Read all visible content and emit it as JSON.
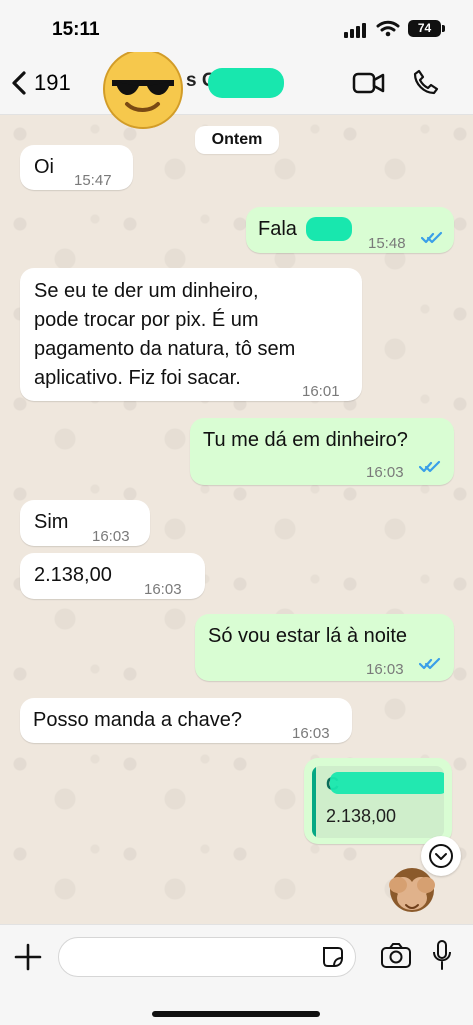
{
  "status_bar": {
    "time": "15:11",
    "battery": "74"
  },
  "header": {
    "back_count": "191",
    "contact_name": "s G"
  },
  "chat": {
    "day_label": "Ontem",
    "messages": [
      {
        "text": "Oi",
        "time": "15:47"
      },
      {
        "text": "Fala",
        "time": "15:48"
      },
      {
        "line1": "Se eu te der um dinheiro,",
        "line2": "pode trocar por pix. É um",
        "line3": "pagamento da natura, tô sem",
        "line4": "aplicativo. Fiz foi sacar.",
        "time": "16:01"
      },
      {
        "text": "Tu me dá em dinheiro?",
        "time": "16:03"
      },
      {
        "text": "Sim",
        "time": "16:03"
      },
      {
        "text": "2.138,00",
        "time": "16:03"
      },
      {
        "text": "Só vou estar lá à noite",
        "time": "16:03"
      },
      {
        "text": "Posso manda a chave?",
        "time": "16:03"
      }
    ],
    "reply_preview": {
      "author": "C",
      "value": "2.138,00"
    }
  },
  "icons": {
    "back": "chevron-left-icon",
    "avatar": "sunglasses-emoji-icon",
    "video": "video-camera-icon",
    "phone": "phone-icon",
    "read": "double-check-icon",
    "scroll": "chevron-down-circle-icon",
    "monkey": "see-no-evil-monkey-icon",
    "plus": "plus-icon",
    "sticker": "sticker-icon",
    "camera": "camera-icon",
    "mic": "microphone-icon"
  },
  "colors": {
    "outgoing_bubble": "#d9fdd3",
    "incoming_bubble": "#ffffff",
    "accent": "#18e7ae",
    "read_check": "#3a9fe8"
  }
}
